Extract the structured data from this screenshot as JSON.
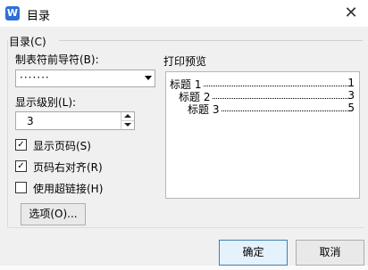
{
  "dialog": {
    "title": "目录",
    "app_icon": "W",
    "close_symbol": "✕"
  },
  "group": {
    "label": "目录(C)"
  },
  "leader": {
    "label": "制表符前导符(B):",
    "value": "·······"
  },
  "levels": {
    "label": "显示级别(L):",
    "value": "3"
  },
  "options": [
    {
      "label": "显示页码(S)",
      "checked": true,
      "mark": "✓"
    },
    {
      "label": "页码右对齐(R)",
      "checked": true,
      "mark": "✓"
    },
    {
      "label": "使用超链接(H)",
      "checked": false,
      "mark": ""
    }
  ],
  "buttons": {
    "options": "选项(O)...",
    "ok": "确定",
    "cancel": "取消"
  },
  "preview": {
    "title": "打印预览",
    "entries": [
      {
        "text": "标题 1",
        "page": "1"
      },
      {
        "text": "标题 2",
        "page": "3"
      },
      {
        "text": "标题 3",
        "page": "5"
      }
    ]
  }
}
